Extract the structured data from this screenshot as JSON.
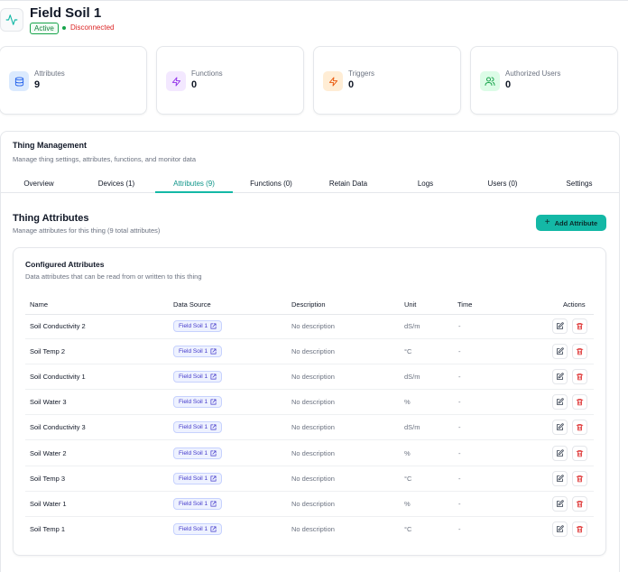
{
  "thing": {
    "name": "Field Soil 1",
    "status_badge": "Active",
    "connection": "Disconnected"
  },
  "stats": [
    {
      "label": "Attributes",
      "value": "9",
      "icon": "database-icon",
      "bg": "#dbeafe",
      "color": "#2563eb"
    },
    {
      "label": "Functions",
      "value": "0",
      "icon": "zap-icon",
      "bg": "#f3e8ff",
      "color": "#9333ea"
    },
    {
      "label": "Triggers",
      "value": "0",
      "icon": "zap-icon",
      "bg": "#ffedd5",
      "color": "#ea580c"
    },
    {
      "label": "Authorized Users",
      "value": "0",
      "icon": "users-icon",
      "bg": "#dcfce7",
      "color": "#16a34a"
    }
  ],
  "management": {
    "title": "Thing Management",
    "subtitle": "Manage thing settings, attributes, functions, and monitor data",
    "tabs": [
      "Overview",
      "Devices (1)",
      "Attributes (9)",
      "Functions (0)",
      "Retain Data",
      "Logs",
      "Users (0)",
      "Settings"
    ],
    "active_tab": "Attributes (9)"
  },
  "attributes_section": {
    "title": "Thing Attributes",
    "subtitle": "Manage attributes for this thing (9 total attributes)",
    "add_button": "Add Attribute"
  },
  "configured": {
    "title": "Configured Attributes",
    "subtitle": "Data attributes that can be read from or written to this thing",
    "columns": [
      "Name",
      "Data Source",
      "Description",
      "Unit",
      "Time",
      "Actions"
    ],
    "rows": [
      {
        "name": "Soil Conductivity 2",
        "source": "Field Soil 1",
        "description": "No description",
        "unit": "dS/m",
        "time": "-"
      },
      {
        "name": "Soil Temp 2",
        "source": "Field Soil 1",
        "description": "No description",
        "unit": "°C",
        "time": "-"
      },
      {
        "name": "Soil Conductivity 1",
        "source": "Field Soil 1",
        "description": "No description",
        "unit": "dS/m",
        "time": "-"
      },
      {
        "name": "Soil Water 3",
        "source": "Field Soil 1",
        "description": "No description",
        "unit": "%",
        "time": "-"
      },
      {
        "name": "Soil Conductivity 3",
        "source": "Field Soil 1",
        "description": "No description",
        "unit": "dS/m",
        "time": "-"
      },
      {
        "name": "Soil Water 2",
        "source": "Field Soil 1",
        "description": "No description",
        "unit": "%",
        "time": "-"
      },
      {
        "name": "Soil Temp 3",
        "source": "Field Soil 1",
        "description": "No description",
        "unit": "°C",
        "time": "-"
      },
      {
        "name": "Soil Water 1",
        "source": "Field Soil 1",
        "description": "No description",
        "unit": "%",
        "time": "-"
      },
      {
        "name": "Soil Temp 1",
        "source": "Field Soil 1",
        "description": "No description",
        "unit": "°C",
        "time": "-"
      }
    ]
  },
  "colors": {
    "accent": "#14b8a6",
    "danger": "#dc2626",
    "success": "#16a34a"
  }
}
